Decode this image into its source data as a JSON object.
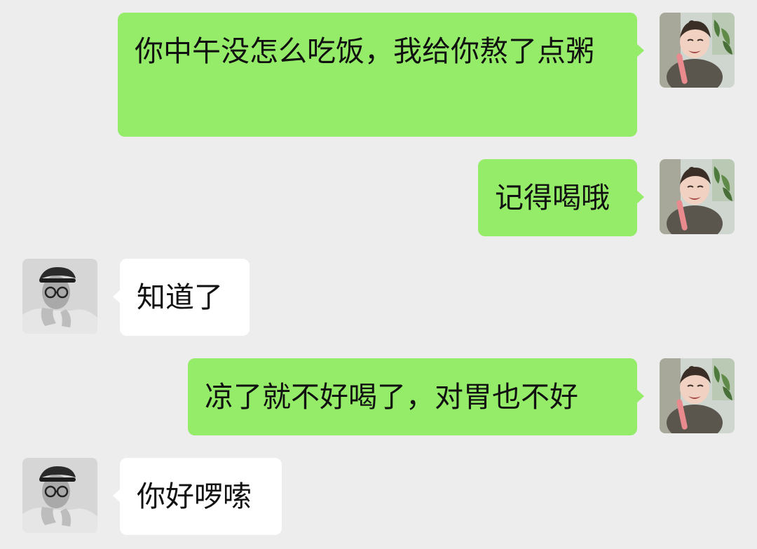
{
  "messages": [
    {
      "sender": "self",
      "text": "你中午没怎么吃饭，我给你熬了点粥"
    },
    {
      "sender": "self",
      "text": "记得喝哦"
    },
    {
      "sender": "peer",
      "text": "知道了"
    },
    {
      "sender": "self",
      "text": "凉了就不好喝了，对胃也不好"
    },
    {
      "sender": "peer",
      "text": "你好啰嗦"
    }
  ],
  "colors": {
    "background": "#ededed",
    "self_bubble": "#95ec69",
    "peer_bubble": "#ffffff"
  },
  "avatars": {
    "self": "girl-crying-photo-avatar",
    "peer": "man-in-cap-grayscale-avatar"
  }
}
